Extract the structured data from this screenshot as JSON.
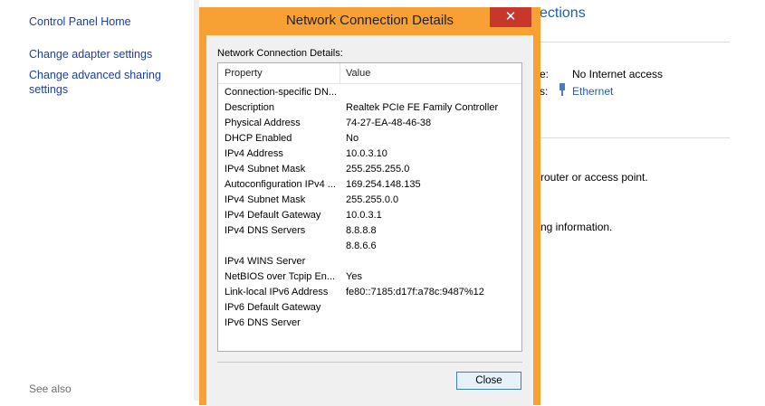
{
  "sidebar": {
    "items": [
      {
        "label": "Control Panel Home"
      },
      {
        "label": "Change adapter settings"
      },
      {
        "label": "Change advanced sharing settings"
      }
    ],
    "see_also": "See also"
  },
  "background": {
    "title_partial": "ections",
    "access_label_partial": "e:",
    "access_value": "No Internet access",
    "connections_label_partial": "s:",
    "connections_link": "Ethernet",
    "router_text_partial": "router or access point.",
    "info_text_partial": "ng information."
  },
  "dialog": {
    "title": "Network Connection Details",
    "close_glyph": "✕",
    "details_label": "Network Connection Details:",
    "columns": {
      "property": "Property",
      "value": "Value"
    },
    "rows": [
      {
        "property": "Connection-specific DN...",
        "value": ""
      },
      {
        "property": "Description",
        "value": "Realtek PCIe FE Family Controller"
      },
      {
        "property": "Physical Address",
        "value": "74-27-EA-48-46-38"
      },
      {
        "property": "DHCP Enabled",
        "value": "No"
      },
      {
        "property": "IPv4 Address",
        "value": "10.0.3.10"
      },
      {
        "property": "IPv4 Subnet Mask",
        "value": "255.255.255.0"
      },
      {
        "property": "Autoconfiguration IPv4 ...",
        "value": "169.254.148.135"
      },
      {
        "property": "IPv4 Subnet Mask",
        "value": "255.255.0.0"
      },
      {
        "property": "IPv4 Default Gateway",
        "value": "10.0.3.1"
      },
      {
        "property": "IPv4 DNS Servers",
        "value": "8.8.8.8"
      },
      {
        "property": "",
        "value": "8.8.6.6"
      },
      {
        "property": "IPv4 WINS Server",
        "value": ""
      },
      {
        "property": "NetBIOS over Tcpip En...",
        "value": "Yes"
      },
      {
        "property": "Link-local IPv6 Address",
        "value": "fe80::7185:d17f:a78c:9487%12"
      },
      {
        "property": "IPv6 Default Gateway",
        "value": ""
      },
      {
        "property": "IPv6 DNS Server",
        "value": ""
      }
    ],
    "close_button": "Close"
  },
  "colors": {
    "dialog_frame": "#f7a034",
    "close_x": "#c7372b",
    "link": "#1a5fb4"
  }
}
